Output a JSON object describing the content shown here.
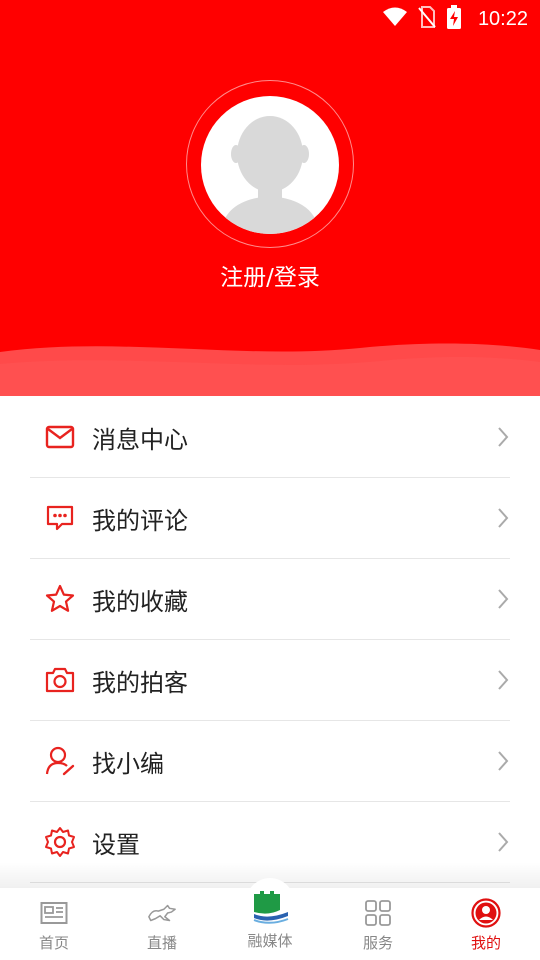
{
  "status_bar": {
    "time": "10:22"
  },
  "profile": {
    "login_label": "注册/登录"
  },
  "menu": {
    "items": [
      {
        "label": "消息中心",
        "icon": "mail-icon"
      },
      {
        "label": "我的评论",
        "icon": "comment-icon"
      },
      {
        "label": "我的收藏",
        "icon": "star-icon"
      },
      {
        "label": "我的拍客",
        "icon": "camera-icon"
      },
      {
        "label": "找小编",
        "icon": "user-edit-icon"
      },
      {
        "label": "设置",
        "icon": "gear-icon"
      }
    ]
  },
  "bottom_nav": {
    "items": [
      {
        "label": "首页",
        "icon": "news-icon"
      },
      {
        "label": "直播",
        "icon": "horse-icon"
      },
      {
        "label": "融媒体",
        "icon": "great-wall-icon"
      },
      {
        "label": "服务",
        "icon": "grid-icon"
      },
      {
        "label": "我的",
        "icon": "profile-icon",
        "active": true
      }
    ]
  },
  "colors": {
    "brand": "#ff0000",
    "active": "#e01010",
    "icon_red": "#e8231f"
  }
}
